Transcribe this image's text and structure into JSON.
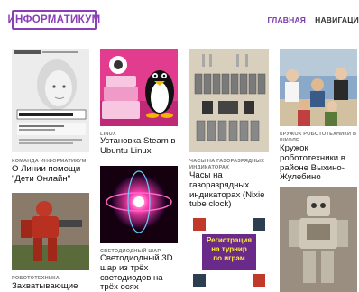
{
  "header": {
    "logo_text": "ИНФОРМАТИКУМ",
    "nav": [
      "ГЛАВНАЯ",
      "НАВИГАЦИ"
    ]
  },
  "posts": [
    {
      "category": "КОМАНДА ИНФОРМАТИКУМ",
      "title": "О Линии помощи \"Дети Онлайн\""
    },
    {
      "category": "LINUX",
      "title": "Установка Steam в Ubuntu Linux"
    },
    {
      "category": "ЧАСЫ НА ГАЗОРАЗРЯДНЫХ ИНДИКАТОРАХ",
      "title": "Часы на газоразрядных индикаторах (Nixie tube clock)"
    },
    {
      "category": "КРУЖОК РОБОТОТЕХНИКИ В ШКОЛЕ",
      "title": "Кружок робототехники в районе Выхино-Жулебино"
    },
    {
      "category": "РОБОТОТЕХНИКА",
      "title": "Захватывающие"
    },
    {
      "category": "СВЕТОДИОДНЫЙ ШАР",
      "title": "Светодиодный 3D шар из трёх светодиодов на трёх осях"
    }
  ],
  "game_poster": {
    "line1": "Регистрация",
    "line2": "на турнир",
    "line3": "по играм"
  },
  "colors": {
    "accent": "#8a3fb5",
    "text": "#111111",
    "category": "#777777"
  }
}
